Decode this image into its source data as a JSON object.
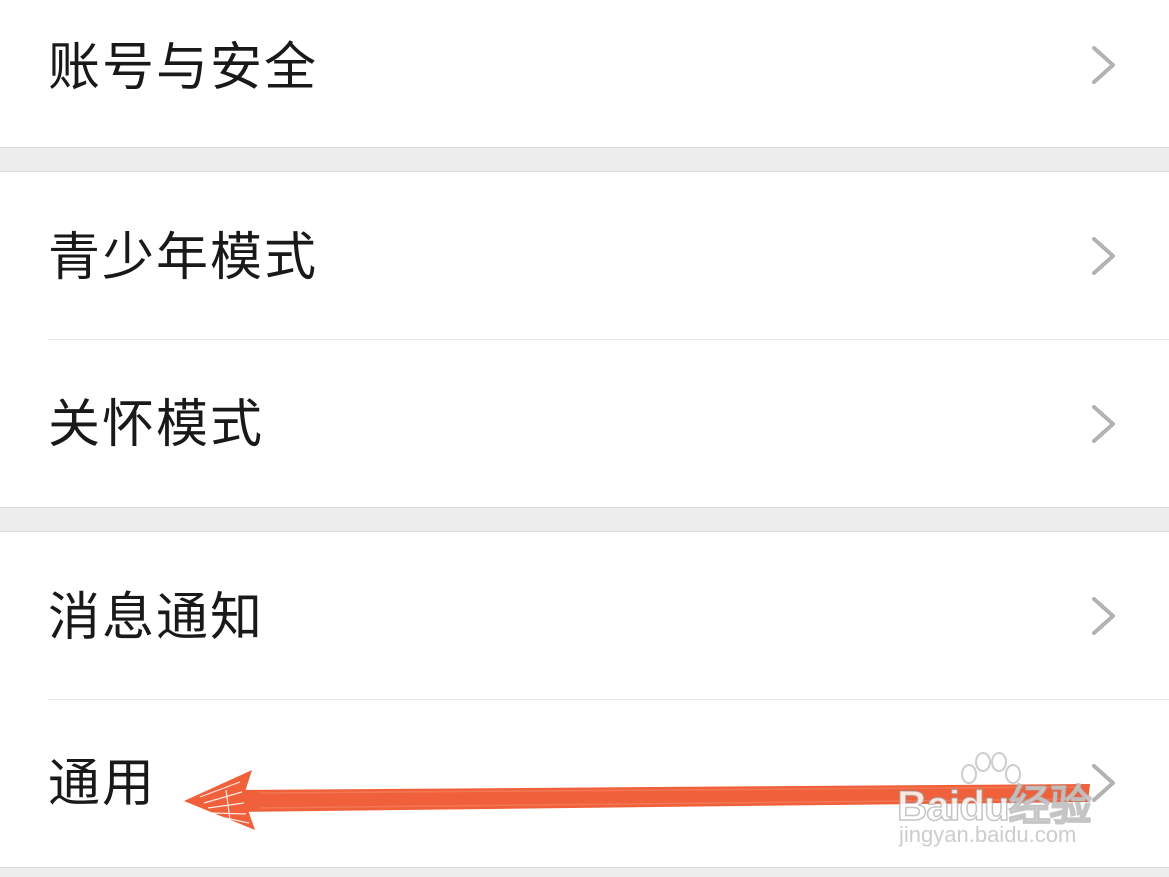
{
  "settings": {
    "items": [
      {
        "label": "账号与安全"
      },
      {
        "label": "青少年模式"
      },
      {
        "label": "关怀模式"
      },
      {
        "label": "消息通知"
      },
      {
        "label": "通用"
      }
    ]
  },
  "annotation": {
    "arrow_color": "#f0603a",
    "points_to": "通用"
  },
  "watermark": {
    "logo_text": "Baidu经验",
    "url_text": "jingyan.baidu.com"
  },
  "colors": {
    "background": "#ededed",
    "row_background": "#ffffff",
    "text": "#191919",
    "chevron": "#b2b2b2",
    "divider": "#e5e5e5"
  },
  "icons": {
    "row_chevron": "chevron-right-icon",
    "watermark_paw": "paw-icon"
  }
}
